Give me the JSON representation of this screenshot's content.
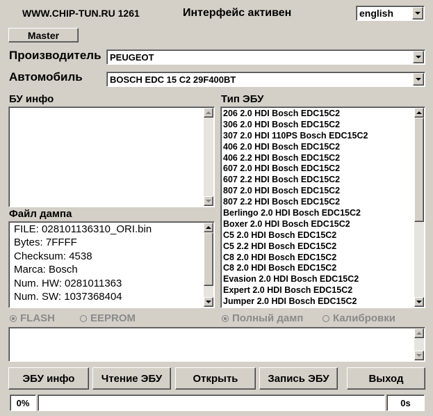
{
  "header": {
    "site": "WWW.CHIP-TUN.RU 1261",
    "status": "Интерфейс активен",
    "language_value": "english"
  },
  "master_button": "Master",
  "manufacturer": {
    "label": "Производитель",
    "value": "PEUGEOT"
  },
  "vehicle": {
    "label": "Автомобиль",
    "value": "BOSCH EDC 15 C2 29F400BT"
  },
  "ecu_info": {
    "label": "БУ инфо"
  },
  "dump_file": {
    "label": "Файл дампа",
    "lines": [
      "FILE: 028101136310_ORI.bin",
      "Bytes: 7FFFF",
      "Checksum: 4538",
      "Marca: Bosch",
      "Num. HW: 0281011363",
      "Num. SW: 1037368404"
    ]
  },
  "ecu_type": {
    "label": "Тип ЭБУ",
    "items": [
      "206 2.0 HDI Bosch EDC15C2",
      "306 2.0 HDI Bosch EDC15C2",
      "307 2.0 HDI 110PS Bosch EDC15C2",
      "406 2.0 HDI Bosch EDC15C2",
      "406 2.2 HDI Bosch EDC15C2",
      "607 2.0 HDI Bosch EDC15C2",
      "607 2.2 HDI Bosch EDC15C2",
      "807 2.0 HDI Bosch EDC15C2",
      "807 2.2 HDI Bosch EDC15C2",
      "Berlingo 2.0 HDI Bosch EDC15C2",
      "Boxer 2.0 HDI Bosch EDC15C2",
      "C5 2.0 HDI Bosch EDC15C2",
      "C5 2.2 HDI Bosch EDC15C2",
      "C8 2.0 HDI Bosch EDC15C2",
      "C8 2.0 HDI Bosch EDC15C2",
      "Evasion 2.0 HDI Bosch EDC15C2",
      "Expert 2.0 HDI Bosch EDC15C2",
      "Jumper 2.0 HDI Bosch EDC15C2"
    ]
  },
  "memory_type": {
    "flash": "FLASH",
    "eeprom": "EEPROM",
    "selected": "flash"
  },
  "dump_mode": {
    "full": "Полный дамп",
    "calib": "Калибровки",
    "selected": "full"
  },
  "buttons": {
    "ecu_info": "ЭБУ инфо",
    "read": "Чтение ЭБУ",
    "open": "Открыть",
    "write": "Запись ЭБУ",
    "exit": "Выход"
  },
  "progress": {
    "percent_label": "0%",
    "time_label": "0s",
    "fraction": 0
  }
}
